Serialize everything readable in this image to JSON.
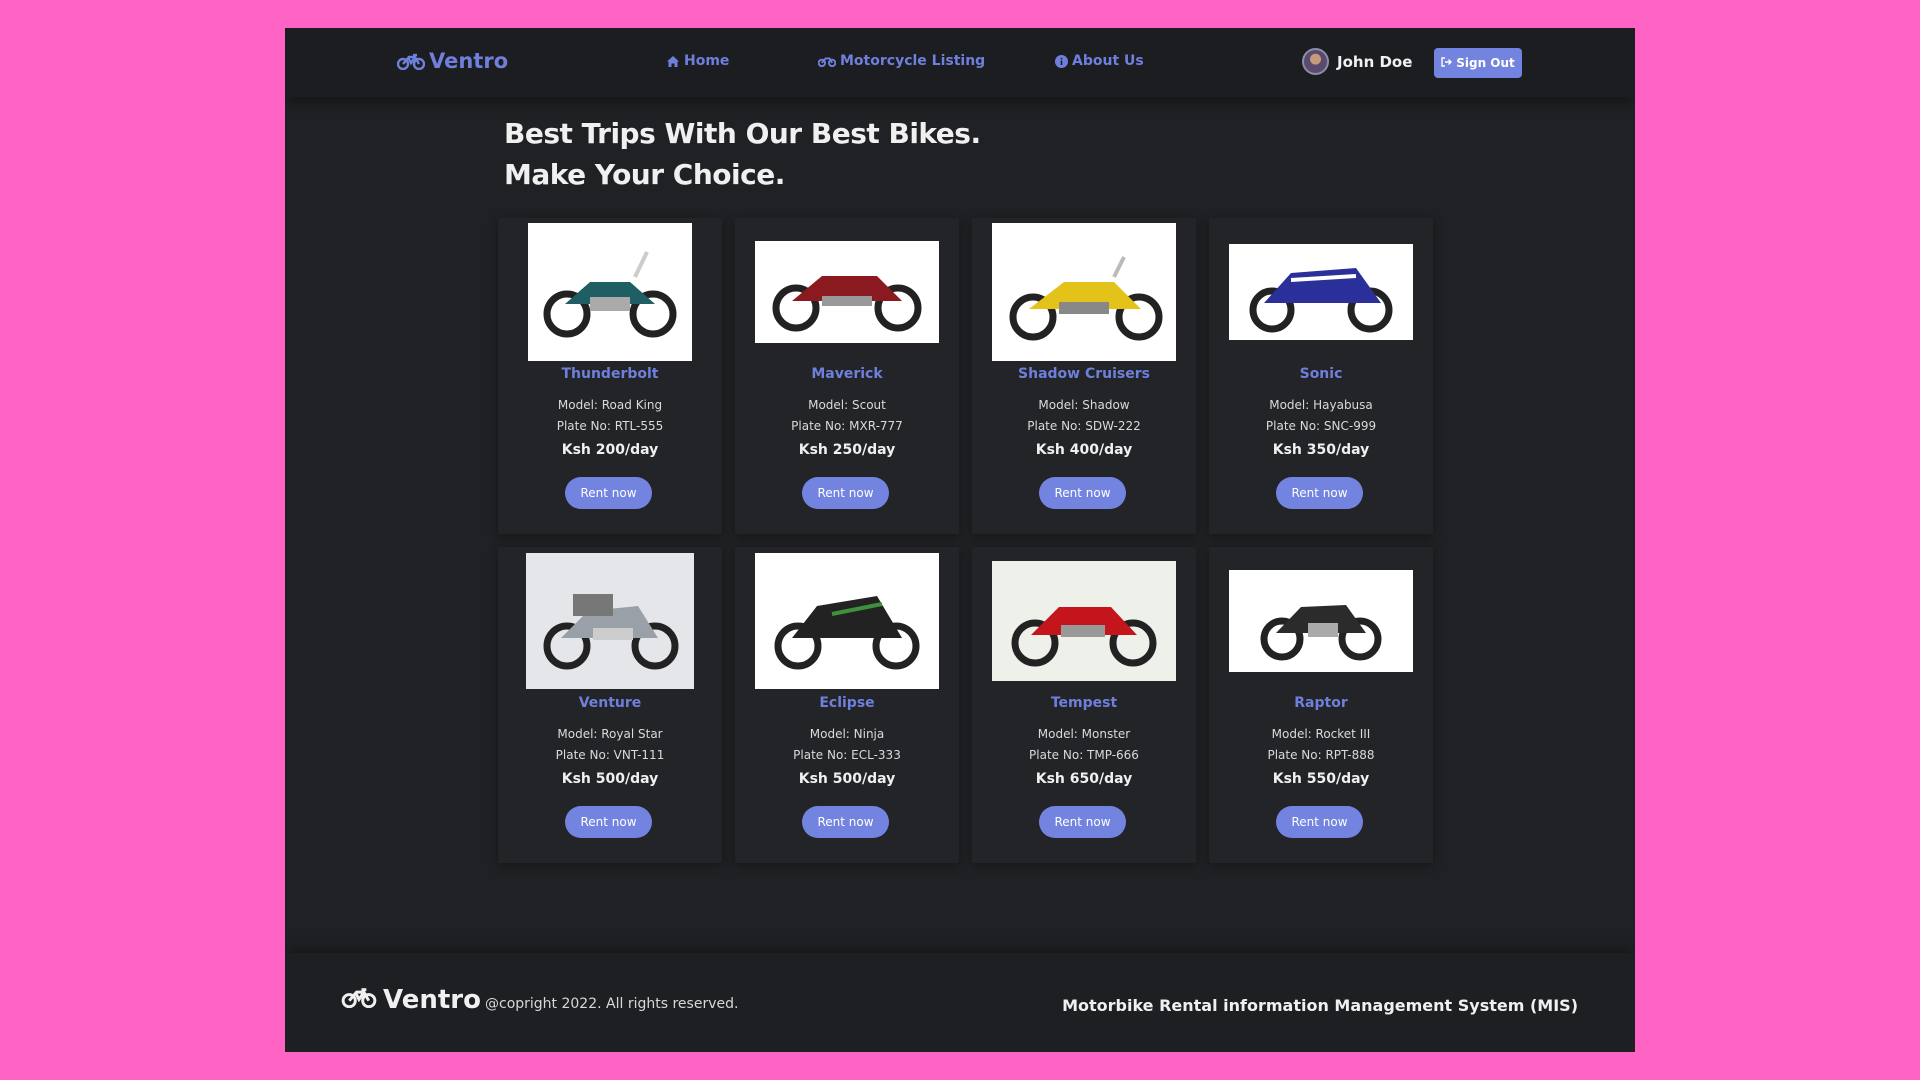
{
  "nav": {
    "brand": "Ventro",
    "links": [
      {
        "label": "Home",
        "icon": "home-icon"
      },
      {
        "label": "Motorcycle Listing",
        "icon": "motorcycle-icon"
      },
      {
        "label": "About Us",
        "icon": "info-icon"
      }
    ],
    "user_name": "John Doe",
    "signout_label": "Sign Out"
  },
  "headline": "Best Trips With Our Best Bikes. Make Your Choice.",
  "bikes": [
    {
      "name": "Thunderbolt",
      "model": "Model: Road King",
      "plate": "Plate No: RTL-555",
      "price": "Ksh 200/day",
      "rent": "Rent now",
      "color": "#1f5e62"
    },
    {
      "name": "Maverick",
      "model": "Model: Scout",
      "plate": "Plate No: MXR-777",
      "price": "Ksh 250/day",
      "rent": "Rent now",
      "color": "#8a1a20"
    },
    {
      "name": "Shadow Cruisers",
      "model": "Model: Shadow",
      "plate": "Plate No: SDW-222",
      "price": "Ksh 400/day",
      "rent": "Rent now",
      "color": "#e3c21a"
    },
    {
      "name": "Sonic",
      "model": "Model: Hayabusa",
      "plate": "Plate No: SNC-999",
      "price": "Ksh 350/day",
      "rent": "Rent now",
      "color": "#2a2f9a"
    },
    {
      "name": "Venture",
      "model": "Model: Royal Star",
      "plate": "Plate No: VNT-111",
      "price": "Ksh 500/day",
      "rent": "Rent now",
      "color": "#9aa0a8"
    },
    {
      "name": "Eclipse",
      "model": "Model: Ninja",
      "plate": "Plate No: ECL-333",
      "price": "Ksh 500/day",
      "rent": "Rent now",
      "color": "#222222"
    },
    {
      "name": "Tempest",
      "model": "Model: Monster",
      "plate": "Plate No: TMP-666",
      "price": "Ksh 650/day",
      "rent": "Rent now",
      "color": "#c4141c"
    },
    {
      "name": "Raptor",
      "model": "Model: Rocket III",
      "plate": "Plate No: RPT-888",
      "price": "Ksh 550/day",
      "rent": "Rent now",
      "color": "#2b2b2b"
    }
  ],
  "footer": {
    "brand": "Ventro",
    "copyright": "@copright 2022. All rights reserved.",
    "system": "Motorbike Rental information Management System (MIS)"
  },
  "colors": {
    "accent": "#7383e0",
    "page_bg": "#ff64c4",
    "app_bg": "#202124"
  }
}
